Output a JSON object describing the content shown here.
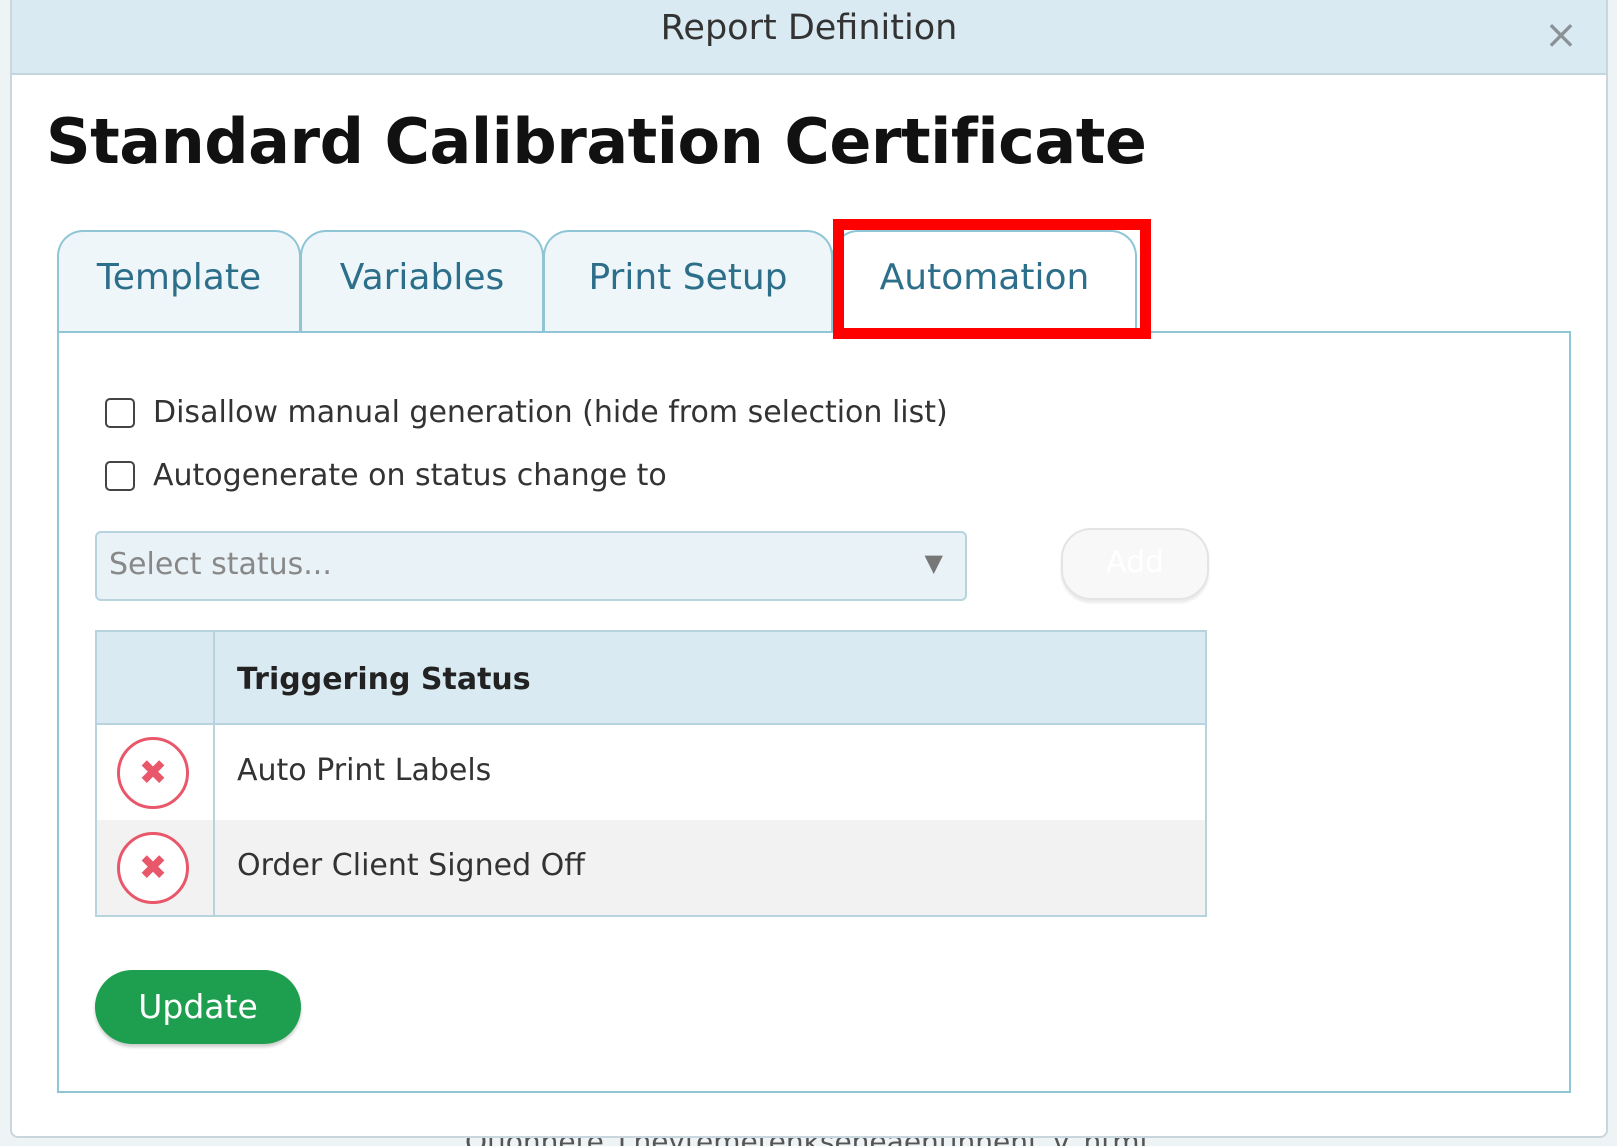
{
  "dialog": {
    "title": "Report Definition",
    "close_symbol": "×"
  },
  "page_title": "Standard Calibration Certificate",
  "tabs": [
    {
      "label": "Template",
      "active": false
    },
    {
      "label": "Variables",
      "active": false
    },
    {
      "label": "Print Setup",
      "active": false
    },
    {
      "label": "Automation",
      "active": true
    }
  ],
  "automation": {
    "disallow_manual_label": "Disallow manual generation (hide from selection list)",
    "disallow_manual_checked": false,
    "autogenerate_label": "Autogenerate on status change to",
    "autogenerate_checked": false,
    "status_select": {
      "placeholder": "Select status...",
      "arrow": "▼"
    },
    "add_button_label": "Add",
    "table": {
      "header": "Triggering Status",
      "rows": [
        {
          "status": "Auto Print Labels"
        },
        {
          "status": "Order Client Signed Off"
        }
      ]
    },
    "remove_symbol": "✖",
    "update_button_label": "Update"
  },
  "background_text": "Otionnete_Lnevtemetenkseneaentinnent_v_ntml",
  "colors": {
    "highlight": "#ff0000",
    "update_button": "#1e9e4f",
    "remove_icon": "#e8576a",
    "tab_text": "#2d6f8a"
  },
  "icons": {
    "close": "close-icon",
    "remove": "remove-icon",
    "dropdown": "chevron-down-icon"
  }
}
